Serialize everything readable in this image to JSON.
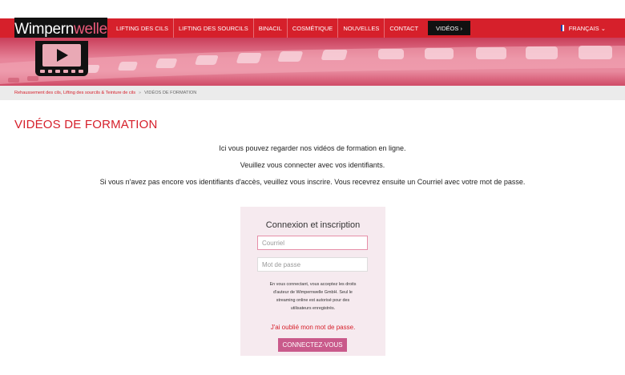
{
  "brand": {
    "logo_part1": "Wimpern",
    "logo_part2": "welle"
  },
  "nav": {
    "items": [
      "LIFTING DES CILS",
      "LIFTING DES SOURCILS",
      "BINACIL",
      "COSMÉTIQUE",
      "NOUVELLES",
      "CONTACT"
    ],
    "active": "VIDÉOS ›",
    "language": "FRANÇAIS ⌄"
  },
  "breadcrumb": {
    "link": "Rehaussement des cils, Lifting des sourcils & Teinture de cils",
    "separator": "»",
    "current": "VIDÉOS DE FORMATION"
  },
  "page": {
    "title": "VIDÉOS DE FORMATION",
    "intro": [
      "Ici vous pouvez regarder nos vidéos de formation en ligne.",
      "Veuillez vous connecter avec vos identifiants.",
      "Si vous n'avez pas encore vos identifiants d'accès, veuillez vous inscrire. Vous recevrez ensuite un Courriel avec votre mot de passe."
    ]
  },
  "login": {
    "title": "Connexion et inscription",
    "email_placeholder": "Courriel",
    "password_placeholder": "Mot de passe",
    "legal": [
      "En vous connectant, vous acceptez les droits",
      "d'auteur de Wimpernwelle GmbH. Seul le",
      "streaming online est autorisé pour des",
      "utilisateurs enregistrés."
    ],
    "forgot": "J'ai oublié mon mot de passe.",
    "submit": "CONNECTEZ-VOUS"
  },
  "colors": {
    "brand_red": "#d6202b",
    "button_pink": "#c95a8b",
    "panel_bg": "#f6eaef"
  },
  "icons": {
    "logo_badge": "video-play-icon",
    "flag": "french-flag-icon"
  }
}
